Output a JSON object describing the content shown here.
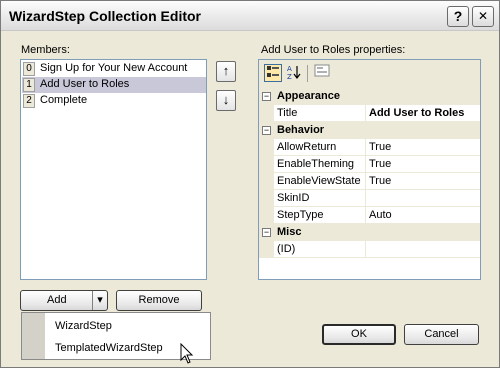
{
  "window": {
    "title": "WizardStep Collection Editor",
    "help_icon": "?",
    "close_icon": "✕"
  },
  "members": {
    "label": "Members:",
    "items": [
      {
        "index": "0",
        "label": "Sign Up for Your New Account"
      },
      {
        "index": "1",
        "label": "Add User to Roles"
      },
      {
        "index": "2",
        "label": "Complete"
      }
    ],
    "selected_index": 1,
    "move_up_icon": "↑",
    "move_down_icon": "↓"
  },
  "buttons": {
    "add": "Add",
    "remove": "Remove",
    "ok": "OK",
    "cancel": "Cancel",
    "dropdown_icon": "▾"
  },
  "add_menu": {
    "items": [
      "WizardStep",
      "TemplatedWizardStep"
    ]
  },
  "properties": {
    "label": "Add User to Roles properties:",
    "toolbar": [
      "categorized-icon",
      "alphabetical-icon",
      "property-pages-icon"
    ],
    "categories": [
      {
        "name": "Appearance",
        "rows": [
          {
            "name": "Title",
            "value": "Add User to Roles"
          }
        ]
      },
      {
        "name": "Behavior",
        "rows": [
          {
            "name": "AllowReturn",
            "value": "True"
          },
          {
            "name": "EnableTheming",
            "value": "True"
          },
          {
            "name": "EnableViewState",
            "value": "True"
          },
          {
            "name": "SkinID",
            "value": ""
          },
          {
            "name": "StepType",
            "value": "Auto"
          }
        ]
      },
      {
        "name": "Misc",
        "rows": [
          {
            "name": "(ID)",
            "value": ""
          }
        ]
      }
    ],
    "expander_symbol": "−"
  }
}
